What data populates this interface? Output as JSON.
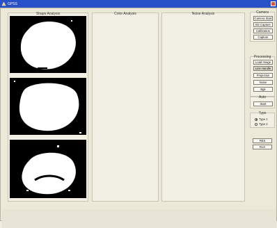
{
  "window": {
    "title": "GPSS",
    "icon": "app-icon",
    "close_icon": "close-icon"
  },
  "panels": {
    "shape_title": "Shape Analysis",
    "color_title": "Color Analysis",
    "noise_title": "Noise Analysis"
  },
  "camera": {
    "title": "Camera",
    "buttons": [
      "Camera Start",
      "BS Capture",
      "Calibration",
      "Capture"
    ]
  },
  "processing": {
    "title": "Processing",
    "buttons": [
      "Load Image",
      "Line Handle",
      "Projection",
      "Noise",
      "Bgk"
    ]
  },
  "auto": {
    "title": "Auto",
    "buttons": [
      "Start"
    ]
  },
  "type": {
    "title": "Type",
    "options": [
      "Type 1",
      "Type 2"
    ],
    "selected": "Type 1"
  },
  "extra": {
    "buttons": [
      "RES",
      "RLG"
    ]
  },
  "colors": {
    "titlebar": "#2a52c8",
    "window_bg": "#ece9d8",
    "image_bg": "#000000",
    "shape_fill": "#ffffff"
  }
}
